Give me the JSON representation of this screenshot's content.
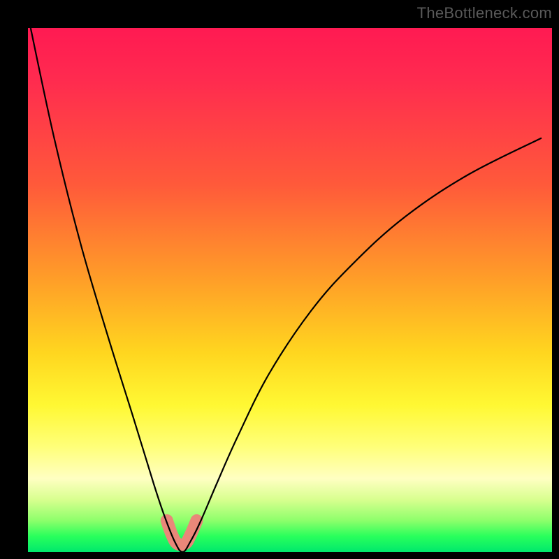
{
  "watermark": "TheBottleneck.com",
  "chart_data": {
    "type": "line",
    "title": "",
    "xlabel": "",
    "ylabel": "",
    "xlim": [
      0,
      100
    ],
    "ylim": [
      0,
      100
    ],
    "grid": false,
    "legend": false,
    "background_gradient": {
      "direction": "vertical",
      "stops": [
        {
          "pos": 0,
          "color": "#ff1a52"
        },
        {
          "pos": 30,
          "color": "#ff5a3a"
        },
        {
          "pos": 62,
          "color": "#ffd61f"
        },
        {
          "pos": 80,
          "color": "#ffff7a"
        },
        {
          "pos": 94,
          "color": "#8dff6b"
        },
        {
          "pos": 100,
          "color": "#00e86c"
        }
      ]
    },
    "series": [
      {
        "name": "bottleneck-curve",
        "stroke": "#000000",
        "x": [
          0.5,
          5,
          10,
          15,
          20,
          24,
          26,
          28,
          29.5,
          31,
          33,
          36,
          40,
          46,
          54,
          62,
          72,
          84,
          98
        ],
        "y": [
          100,
          79,
          59,
          42,
          26,
          13,
          7,
          2,
          0,
          2,
          6,
          13,
          22,
          34,
          46,
          55,
          64,
          72,
          79
        ]
      },
      {
        "name": "optimal-range-highlight",
        "stroke": "#e98779",
        "stroke_width": 18,
        "x": [
          26.5,
          27.5,
          28.5,
          30.0,
          31.0,
          32.2
        ],
        "y": [
          6.0,
          3.2,
          1.6,
          1.6,
          3.2,
          6.0
        ]
      }
    ],
    "note": "Values approximate; y=0 is the bottom (green) edge, y=100 is the top (red) edge."
  }
}
